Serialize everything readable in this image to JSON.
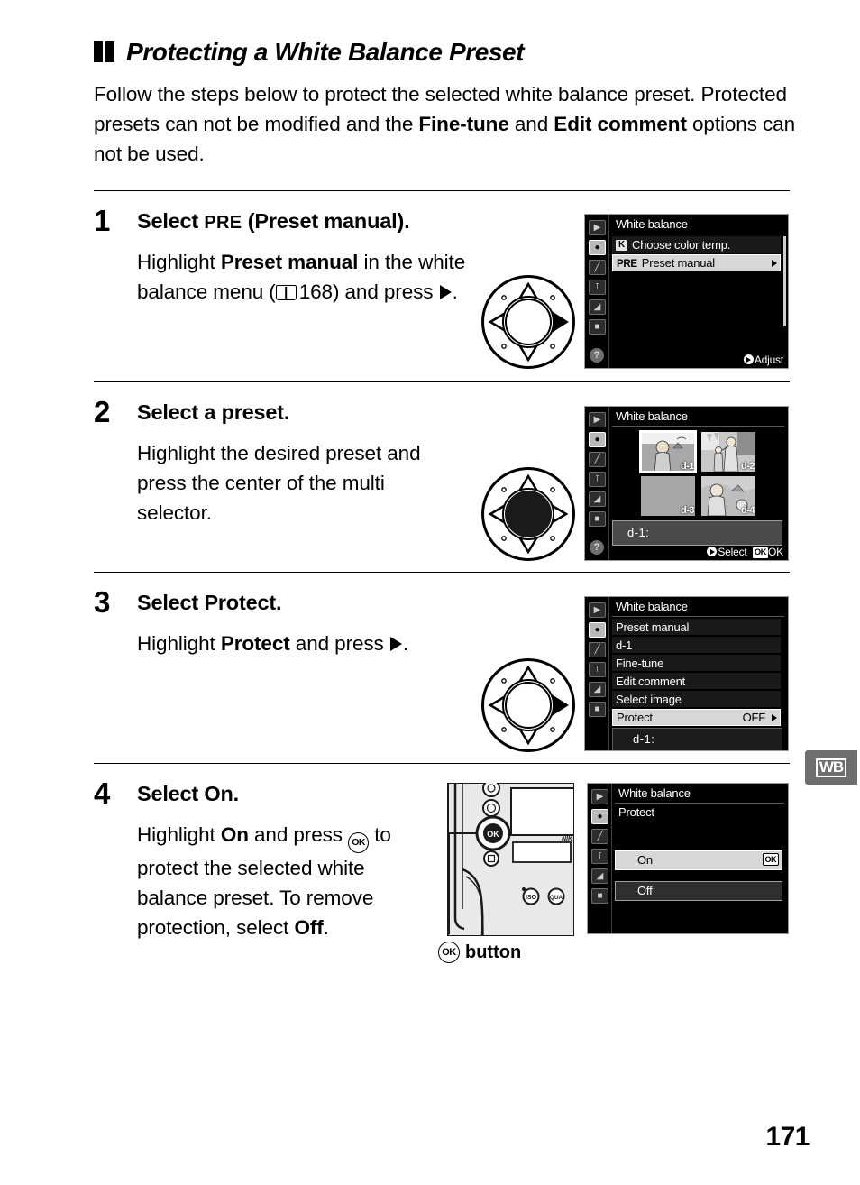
{
  "page": {
    "number": "171",
    "side_tab": "WB"
  },
  "section": {
    "title": "Protecting a White Balance Preset",
    "intro_1": "Follow the steps below to protect the selected white balance preset.  Protected presets can not be modified and the ",
    "intro_bold_1": "Fine-tune",
    "intro_2": " and ",
    "intro_bold_2": "Edit comment",
    "intro_3": " options can not be used."
  },
  "steps": [
    {
      "number": "1",
      "title_pre": "Select ",
      "title_mono": "PRE",
      "title_paren_open": " (",
      "title_bold": "Preset manual",
      "title_paren_close": ").",
      "body_1": "Highlight ",
      "body_bold": "Preset manual",
      "body_2": " in the white balance menu (",
      "body_ref": "168",
      "body_3": ") and press ",
      "body_4": ".",
      "dial": "right-pressed"
    },
    {
      "number": "2",
      "title": "Select a preset.",
      "body": "Highlight the desired preset and press the center of the multi selector.",
      "dial": "center-pressed"
    },
    {
      "number": "3",
      "title_pre": "Select ",
      "title_bold": "Protect",
      "title_end": ".",
      "body_1": "Highlight ",
      "body_bold": "Protect",
      "body_2": " and press ",
      "body_3": ".",
      "dial": "right-pressed"
    },
    {
      "number": "4",
      "title_pre": "Select ",
      "title_bold": "On",
      "title_end": ".",
      "body_1": "Highlight ",
      "body_bold": "On",
      "body_2": " and press ",
      "body_3": " to protect the selected white balance preset.  To remove protection, select ",
      "body_bold_2": "Off",
      "body_4": "."
    }
  ],
  "screens": {
    "step1": {
      "title": "White balance",
      "rows": [
        {
          "badge": "K",
          "badge_type": "k",
          "label": "Choose color temp.",
          "selected": false
        },
        {
          "badge": "PRE",
          "badge_type": "pre",
          "label": "Preset manual",
          "selected": true,
          "caret": true
        }
      ],
      "footer_label": "Adjust"
    },
    "step2": {
      "title": "White balance",
      "thumbnails": [
        {
          "label": "d-1",
          "selected": true,
          "kind": "portrait-landscape"
        },
        {
          "label": "d-2",
          "selected": false,
          "kind": "two-people"
        },
        {
          "label": "d-3",
          "selected": false,
          "kind": "blank-gray"
        },
        {
          "label": "d-4",
          "selected": false,
          "kind": "portrait-closeup"
        }
      ],
      "info_label": "d-1:",
      "footer_select": "Select",
      "footer_ok_badge": "OK",
      "footer_ok_label": "OK"
    },
    "step3": {
      "title": "White balance",
      "rows": [
        {
          "label": "Preset manual",
          "selected": false
        },
        {
          "label": "d-1",
          "selected": false
        },
        {
          "label": "Fine-tune",
          "selected": false
        },
        {
          "label": "Edit comment",
          "selected": false
        },
        {
          "label": "Select image",
          "selected": false
        },
        {
          "label": "Protect",
          "value": "OFF",
          "selected": true,
          "caret": true
        }
      ],
      "info_label": "d-1:"
    },
    "step4": {
      "title": "White balance",
      "subtitle": "Protect",
      "options": [
        {
          "label": "On",
          "selected": true,
          "badge": "OK"
        },
        {
          "label": "Off",
          "selected": false
        }
      ]
    },
    "sidebar_icons": [
      "playback-icon",
      "shooting-menu-icon",
      "custom-settings-icon",
      "setup-menu-icon",
      "retouch-menu-icon",
      "recent-settings-icon"
    ],
    "help_icon": "?"
  },
  "camera_illustration": {
    "ok_button_caption": "button",
    "ok_button_glyph": "OK",
    "buttons": [
      "zoom-in",
      "zoom-out",
      "ok",
      "info"
    ],
    "brand": "NIK"
  },
  "colors": {
    "page_bg": "#ffffff",
    "text": "#000000",
    "lcd_bg": "#000000",
    "lcd_row": "#191919",
    "lcd_selected": "#d7d7d7",
    "tab_gray": "#6e6e6e",
    "thumb_gray": "#9a9a9a"
  }
}
